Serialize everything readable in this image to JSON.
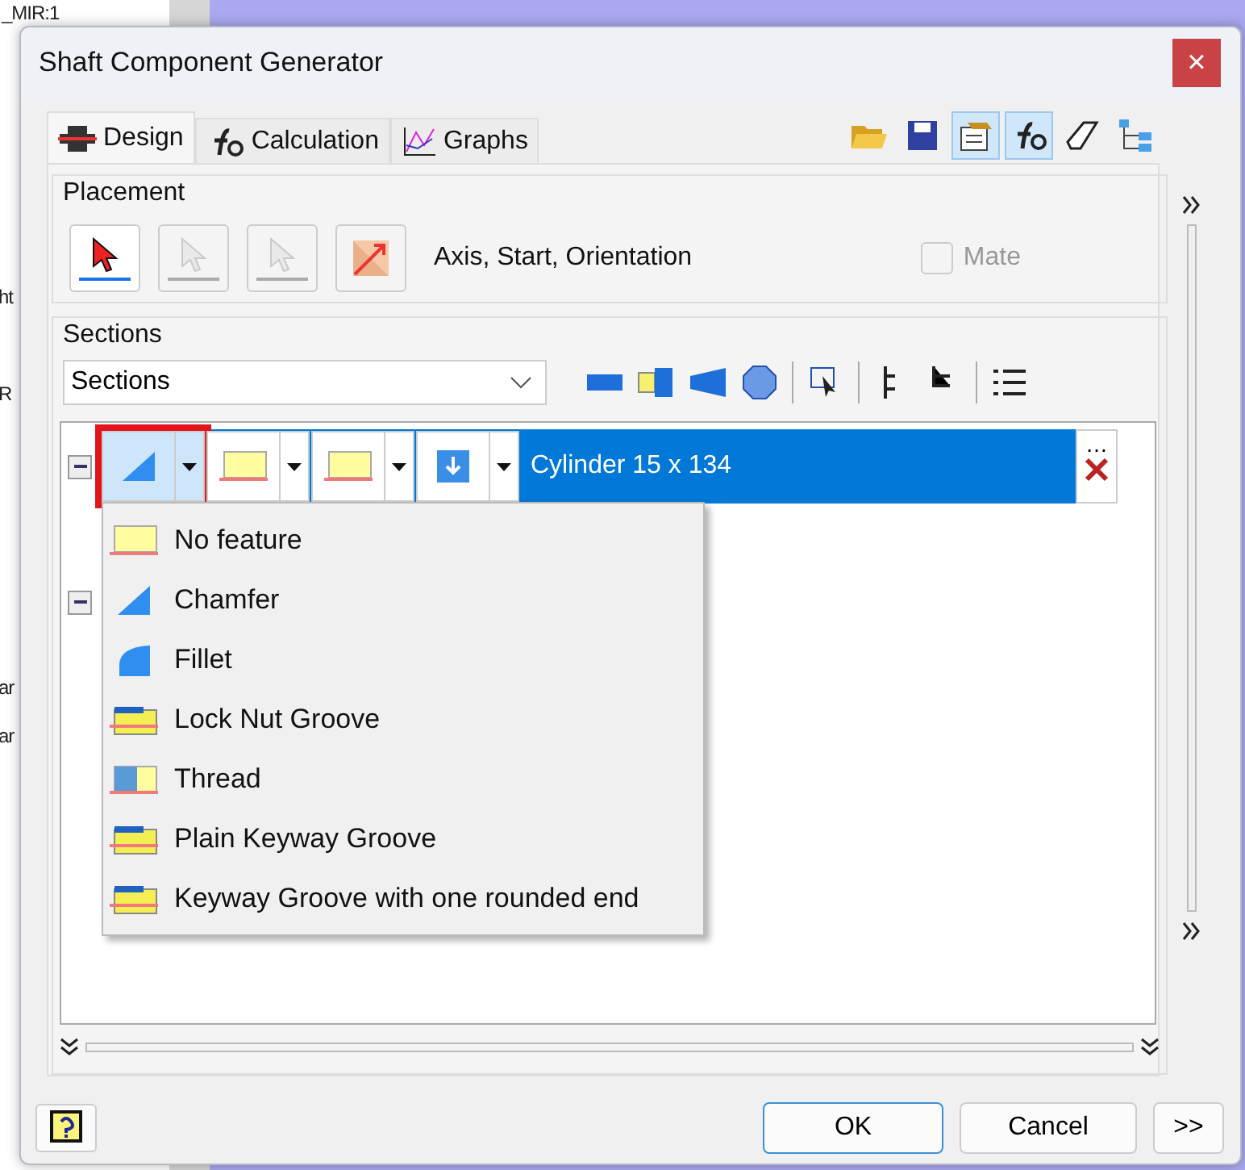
{
  "background_texts": [
    "_MIR:1",
    "ht",
    "R",
    "ar",
    "ar"
  ],
  "window": {
    "title": "Shaft Component Generator",
    "close": "×"
  },
  "tabs": [
    {
      "label": "Design",
      "selected": true,
      "kind": "design"
    },
    {
      "label": "Calculation",
      "selected": false,
      "kind": "calc"
    },
    {
      "label": "Graphs",
      "selected": false,
      "kind": "graph"
    }
  ],
  "toolbar": [
    {
      "kind": "open",
      "selected": false
    },
    {
      "kind": "save",
      "selected": false
    },
    {
      "kind": "options",
      "selected": true
    },
    {
      "kind": "calc",
      "selected": true
    },
    {
      "kind": "eraser",
      "selected": false
    },
    {
      "kind": "tree",
      "selected": false
    }
  ],
  "placement": {
    "label": "Placement",
    "buttons": [
      {
        "kind": "axis",
        "selected": true,
        "disabled": false
      },
      {
        "kind": "start",
        "selected": false,
        "disabled": true
      },
      {
        "kind": "orient",
        "selected": false,
        "disabled": true
      },
      {
        "kind": "flip",
        "selected": false,
        "disabled": false
      }
    ],
    "hint": "Axis, Start, Orientation",
    "mate": {
      "label": "Mate",
      "checked": false,
      "disabled": true
    }
  },
  "sections": {
    "label": "Sections",
    "combo": "Sections",
    "tools": [
      {
        "kind": "cylinder"
      },
      {
        "kind": "cone"
      },
      {
        "kind": "polygon"
      },
      {
        "kind": "sphere"
      },
      {
        "kind": "select"
      },
      {
        "kind": "tree"
      },
      {
        "kind": "tree2"
      },
      {
        "kind": "list"
      }
    ],
    "rows": [
      {
        "features": [
          {
            "kind": "chamfer"
          },
          {
            "kind": "nofeature"
          },
          {
            "kind": "nofeature"
          },
          {
            "kind": "arrow"
          }
        ],
        "open_feature": true,
        "label": "Cylinder 15 x 134",
        "selected": true,
        "more": "…"
      }
    ],
    "menu": [
      {
        "label": "No feature",
        "kind": "nofeature"
      },
      {
        "label": "Chamfer",
        "kind": "chamfer"
      },
      {
        "label": "Fillet",
        "kind": "fillet"
      },
      {
        "label": "Lock Nut Groove",
        "kind": "groove"
      },
      {
        "label": "Thread",
        "kind": "thread"
      },
      {
        "label": "Plain Keyway Groove",
        "kind": "groove"
      },
      {
        "label": "Keyway Groove with one rounded end",
        "kind": "groove"
      }
    ]
  },
  "buttons": [
    {
      "label": "OK",
      "selected": true
    },
    {
      "label": "Cancel",
      "selected": false
    },
    {
      "label": ">>",
      "selected": false
    }
  ]
}
